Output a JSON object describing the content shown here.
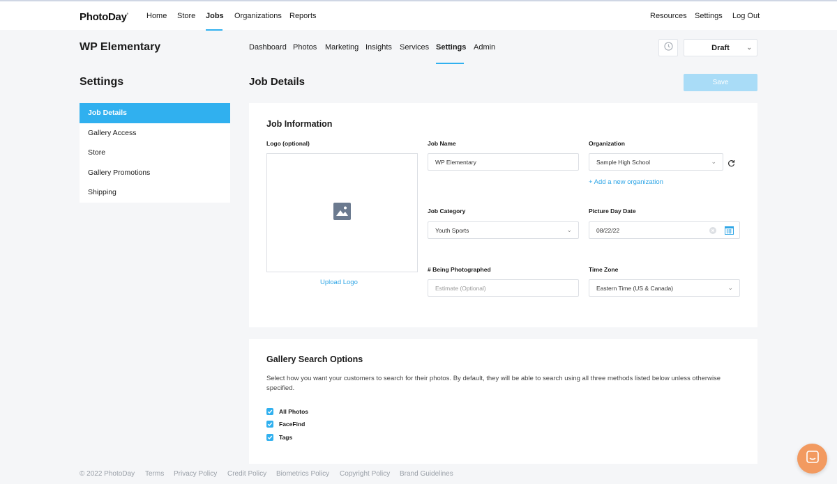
{
  "brand": {
    "logo": "PhotoDay",
    "accent": "#30b0ef"
  },
  "topnav": {
    "left": [
      "Home",
      "Store",
      "Jobs",
      "Organizations",
      "Reports"
    ],
    "active": "Jobs",
    "right": [
      "Resources",
      "Settings",
      "Log Out"
    ]
  },
  "job": {
    "title": "WP Elementary",
    "tabs": [
      "Dashboard",
      "Photos",
      "Marketing",
      "Insights",
      "Services",
      "Settings",
      "Admin"
    ],
    "active_tab": "Settings",
    "status": "Draft"
  },
  "sidebar": {
    "title": "Settings",
    "items": [
      "Job Details",
      "Gallery Access",
      "Store",
      "Gallery Promotions",
      "Shipping"
    ],
    "active": "Job Details"
  },
  "main": {
    "title": "Job Details",
    "save_label": "Save"
  },
  "job_info": {
    "title": "Job Information",
    "logo_label": "Logo (optional)",
    "upload_logo": "Upload Logo",
    "job_name_label": "Job Name",
    "job_name_value": "WP Elementary",
    "organization_label": "Organization",
    "organization_value": "Sample High School",
    "add_org": "+ Add a new organization",
    "job_category_label": "Job Category",
    "job_category_value": "Youth Sports",
    "picture_day_label": "Picture Day Date",
    "picture_day_value": "08/22/22",
    "being_photographed_label": "# Being Photographed",
    "being_photographed_placeholder": "Estimate (Optional)",
    "time_zone_label": "Time Zone",
    "time_zone_value": "Eastern Time (US & Canada)"
  },
  "gallery_search": {
    "title": "Gallery Search Options",
    "description": "Select how you want your customers to search for their photos. By default, they will be able to search using all three methods listed below unless otherwise specified.",
    "options": [
      {
        "label": "All Photos",
        "checked": true
      },
      {
        "label": "FaceFind",
        "checked": true
      },
      {
        "label": "Tags",
        "checked": true
      }
    ]
  },
  "footer": {
    "copyright": "© 2022 PhotoDay",
    "links": [
      "Terms",
      "Privacy Policy",
      "Credit Policy",
      "Biometrics Policy",
      "Copyright Policy",
      "Brand Guidelines"
    ]
  },
  "icons": {
    "history": "clock-icon",
    "refresh": "refresh-icon",
    "calendar": "calendar-icon",
    "clear": "clear-icon",
    "image_placeholder": "image-icon",
    "chat": "chat-icon"
  }
}
